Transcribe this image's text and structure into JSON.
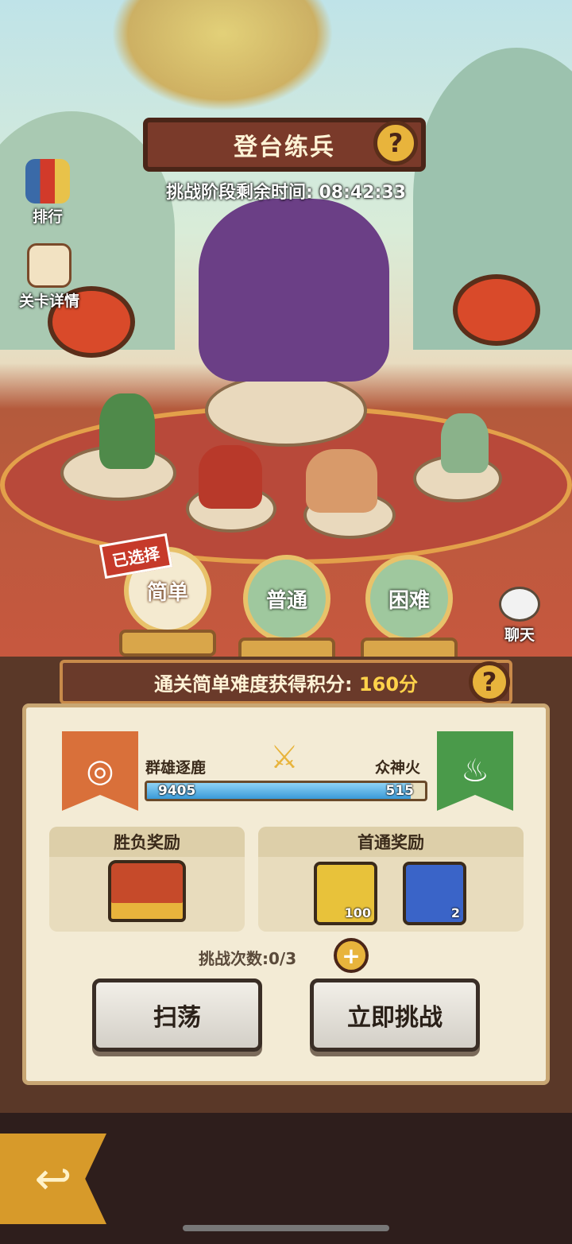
{
  "event": {
    "title": "登台练兵",
    "timer": "挑战阶段剩余时间: 08:42:33"
  },
  "side": {
    "rank_label": "排行",
    "stage_label": "关卡详情",
    "chat_label": "聊天"
  },
  "difficulty": {
    "selected_tag": "已选择",
    "easy": "简单",
    "normal": "普通",
    "hard": "困难"
  },
  "score": {
    "text": "通关简单难度获得积分:",
    "points": "160分"
  },
  "teams": {
    "left_name": "群雄逐鹿",
    "right_name": "众神火",
    "left_score": "9405",
    "right_score": "515",
    "left_share": 0.948
  },
  "rewards": {
    "win_title": "胜负奖励",
    "first_title": "首通奖励",
    "items": [
      {
        "icon": "dragon-coin-icon",
        "count": "100"
      },
      {
        "icon": "mystery-chest-icon",
        "count": "2"
      }
    ]
  },
  "attempts": "挑战次数:0/3",
  "buttons": {
    "sweep": "扫荡",
    "challenge": "立即挑战"
  },
  "icons": {
    "help": "?",
    "plus": "+",
    "back": "↩"
  }
}
